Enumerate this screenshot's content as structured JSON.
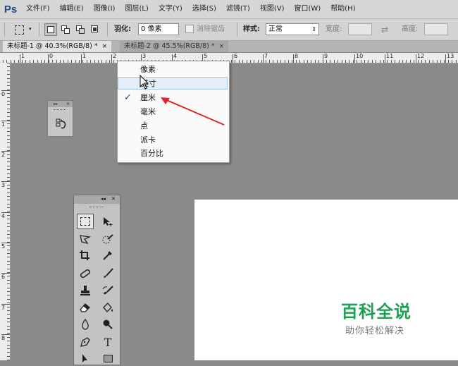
{
  "app": {
    "logo": "Ps"
  },
  "menu": [
    "文件(F)",
    "编辑(E)",
    "图像(I)",
    "图层(L)",
    "文字(Y)",
    "选择(S)",
    "滤镜(T)",
    "视图(V)",
    "窗口(W)",
    "帮助(H)"
  ],
  "options": {
    "feather_label": "羽化:",
    "feather_value": "0 像素",
    "antialias_label": "消除锯齿",
    "style_label": "样式:",
    "style_value": "正常",
    "width_label": "宽度:",
    "height_label": "高度:"
  },
  "tabs": [
    {
      "label": "未标题-1 @ 40.3%(RGB/8) *",
      "close": "×"
    },
    {
      "label": "未标题-2 @ 45.5%(RGB/8) *",
      "close": "×"
    }
  ],
  "ruler_h": [
    "1",
    "0",
    "1",
    "2",
    "3",
    "4",
    "5",
    "6",
    "7",
    "8",
    "9",
    "10",
    "11",
    "12",
    "13"
  ],
  "ruler_v": [
    "0",
    "1",
    "2",
    "3",
    "4",
    "5",
    "6",
    "7",
    "8"
  ],
  "units_menu": {
    "items": [
      "像素",
      "英寸",
      "厘米",
      "毫米",
      "点",
      "派卡",
      "百分比"
    ],
    "hovered": "英寸",
    "checked": "厘米",
    "check_mark": "✓"
  },
  "watermark": {
    "title": "百科全说",
    "subtitle": "助你轻松解决"
  },
  "colors": {
    "accent_arrow": "#e0262a",
    "watermark_green": "#1fa052"
  },
  "icons": [
    "rectangular-marquee-icon",
    "move-icon",
    "lasso-icon",
    "quick-select-icon",
    "crop-icon",
    "eyedropper-icon",
    "healing-brush-icon",
    "brush-icon",
    "clone-stamp-icon",
    "history-brush-icon",
    "eraser-icon",
    "paint-bucket-icon",
    "blur-icon",
    "dodge-icon",
    "pen-icon",
    "type-icon"
  ]
}
